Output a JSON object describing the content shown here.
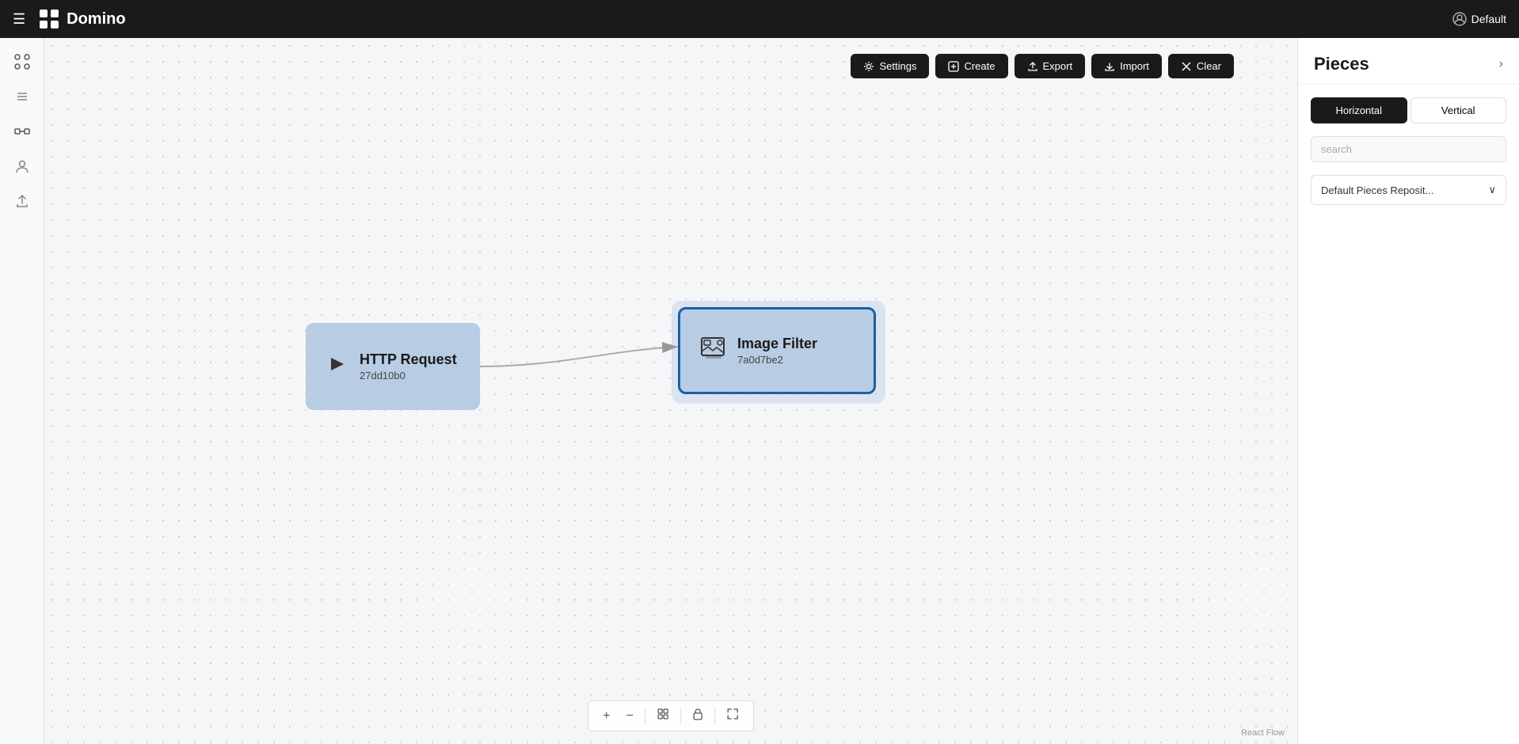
{
  "app": {
    "title": "Domino",
    "logo_text": "Domino",
    "user_label": "Default"
  },
  "toolbar": {
    "settings_label": "Settings",
    "create_label": "Create",
    "export_label": "Export",
    "import_label": "Import",
    "clear_label": "Clear"
  },
  "sidebar": {
    "items": [
      {
        "name": "hamburger-icon",
        "symbol": "☰"
      },
      {
        "name": "list-icon",
        "symbol": "≡"
      },
      {
        "name": "flow-icon",
        "symbol": "⊞"
      },
      {
        "name": "user-icon",
        "symbol": "👤"
      },
      {
        "name": "export-icon",
        "symbol": "↗"
      }
    ]
  },
  "nodes": {
    "http": {
      "title": "HTTP Request",
      "id": "27dd10b0"
    },
    "image": {
      "title": "Image Filter",
      "id": "7a0d7be2"
    }
  },
  "controls": {
    "zoom_in": "+",
    "zoom_out": "−",
    "fit": "⊡",
    "lock": "🔒",
    "fullscreen": "⤢"
  },
  "react_flow_label": "React Flow",
  "right_panel": {
    "title": "Pieces",
    "collapse_symbol": "›",
    "tabs": [
      {
        "label": "Horizontal",
        "active": true
      },
      {
        "label": "Vertical",
        "active": false
      }
    ],
    "search_placeholder": "search",
    "dropdown_label": "Default Pieces Reposit...",
    "dropdown_symbol": "∨"
  }
}
